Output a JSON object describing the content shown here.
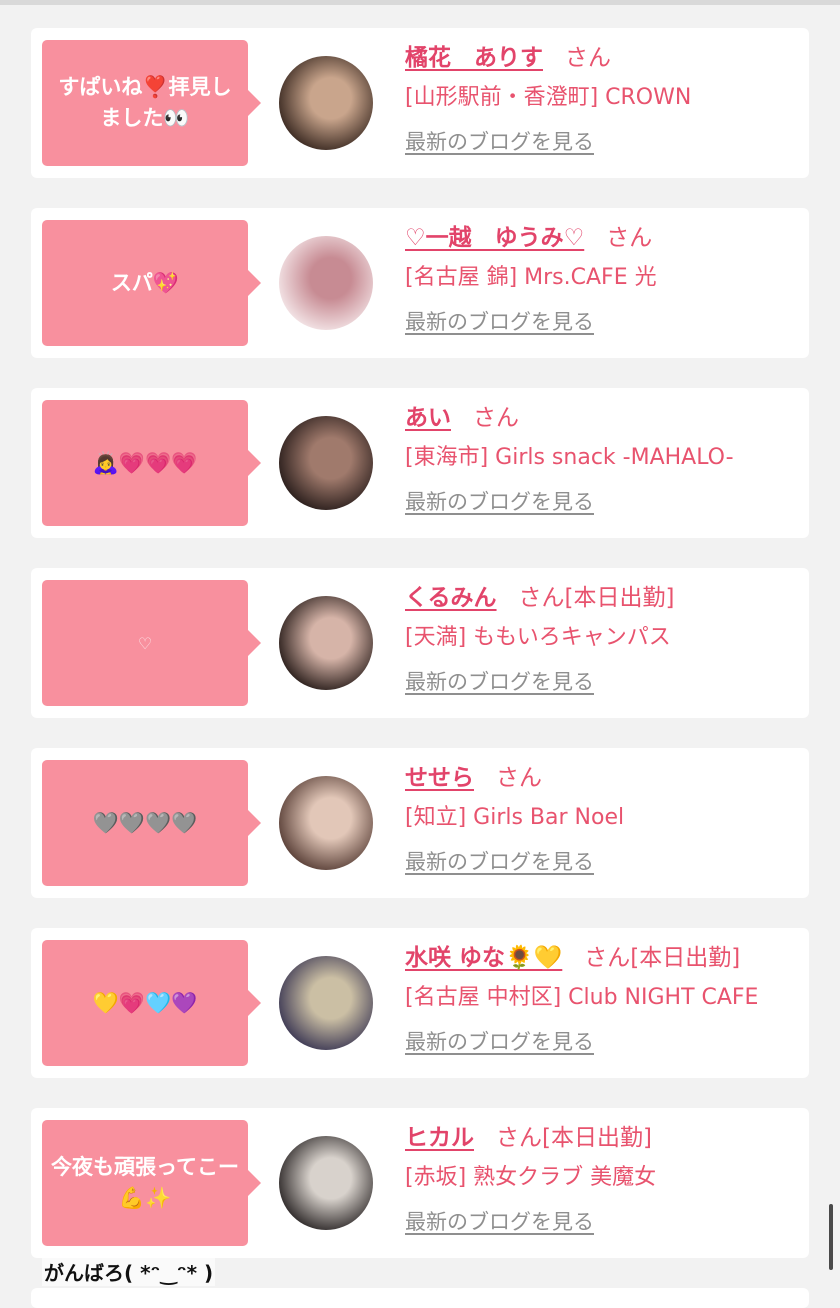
{
  "posts": [
    {
      "message": "すぱいね❣️拝見しました👀",
      "name": "橘花　ありす",
      "san": "さん",
      "shop": "[山形駅前・香澄町] CROWN",
      "blog_link": "最新のブログを見る",
      "avatar_colors": [
        "#3b2a22",
        "#c9a58c"
      ]
    },
    {
      "message": "スパ💖",
      "name": "♡一越　ゆうみ♡",
      "san": "さん",
      "shop": "[名古屋 錦] Mrs.CAFE 光",
      "blog_link": "最新のブログを見る",
      "avatar_colors": [
        "#f3e4e6",
        "#c78b93"
      ]
    },
    {
      "message": "🙇‍♀️💗💗💗",
      "name": "あい",
      "san": "さん",
      "shop": "[東海市] Girls snack -MAHALO-",
      "blog_link": "最新のブログを見る",
      "avatar_colors": [
        "#2a1e1c",
        "#a07a6c"
      ]
    },
    {
      "message": "♡",
      "name": "くるみん",
      "san": "さん[本日出勤]",
      "shop": "[天満] ももいろキャンパス",
      "blog_link": "最新のブログを見る",
      "avatar_colors": [
        "#2b1f1c",
        "#d6b4a8"
      ]
    },
    {
      "message": "🩶🩶🩶🩶",
      "name": "せせら",
      "san": "さん",
      "shop": "[知立] Girls Bar Noel",
      "blog_link": "最新のブログを見る",
      "avatar_colors": [
        "#5a4038",
        "#e2c7b8"
      ]
    },
    {
      "message": "💛💗🩵💜",
      "name": "水咲 ゆな🌻💛",
      "san": "さん[本日出勤]",
      "shop": "[名古屋 中村区] Club NIGHT CAFE",
      "blog_link": "最新のブログを見る",
      "avatar_colors": [
        "#3e3a55",
        "#cbbfa4"
      ]
    },
    {
      "message": "今夜も頑張ってこー💪✨",
      "name": "ヒカル",
      "san": "さん[本日出勤]",
      "shop": "[赤坂] 熟女クラブ 美魔女",
      "blog_link": "最新のブログを見る",
      "avatar_colors": [
        "#2f2a2a",
        "#d8d2cc"
      ]
    }
  ],
  "caption": "がんばろ( *ᵔ‿ᵔ* )",
  "colors": {
    "bubble": "#f8909e",
    "accent": "#e2446a",
    "link_gray": "#8f8f8f"
  }
}
